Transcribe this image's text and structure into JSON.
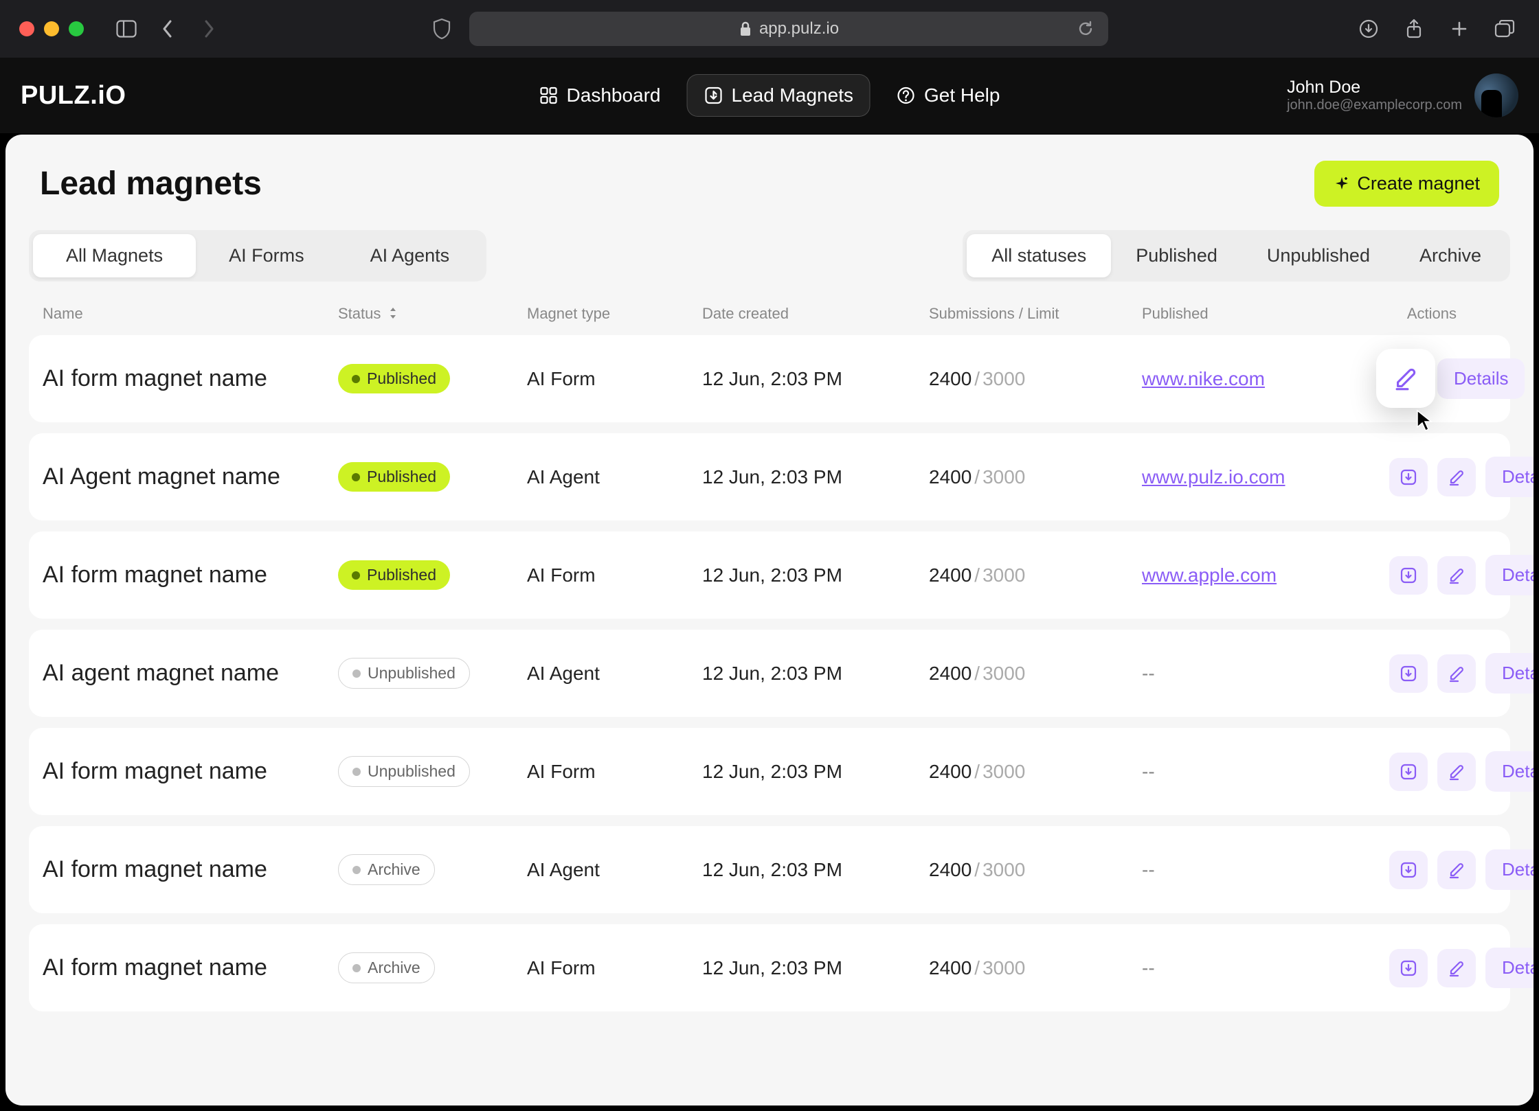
{
  "browser": {
    "url": "app.pulz.io"
  },
  "brand": {
    "logo_text": "PULZ.iO"
  },
  "nav": {
    "items": [
      {
        "label": "Dashboard",
        "active": false
      },
      {
        "label": "Lead Magnets",
        "active": true
      },
      {
        "label": "Get Help",
        "active": false
      }
    ]
  },
  "user": {
    "name": "John Doe",
    "email": "john.doe@examplecorp.com"
  },
  "page": {
    "title": "Lead magnets",
    "create_label": "Create magnet"
  },
  "type_filter": {
    "options": [
      "All Magnets",
      "AI Forms",
      "AI Agents"
    ],
    "active": "All Magnets"
  },
  "status_filter": {
    "options": [
      "All statuses",
      "Published",
      "Unpublished",
      "Archive"
    ],
    "active": "All statuses"
  },
  "table": {
    "columns": {
      "name": "Name",
      "status": "Status",
      "type": "Magnet type",
      "date": "Date created",
      "subs": "Submissions / Limit",
      "published": "Published",
      "actions": "Actions"
    },
    "details_label": "Details",
    "rows": [
      {
        "name": "AI form magnet name",
        "status": "Published",
        "type": "AI Form",
        "date": "12 Jun, 2:03 PM",
        "used": "2400",
        "limit": "3000",
        "published": "www.nike.com",
        "edit_hover": true
      },
      {
        "name": "AI Agent magnet name",
        "status": "Published",
        "type": "AI Agent",
        "date": "12 Jun, 2:03 PM",
        "used": "2400",
        "limit": "3000",
        "published": "www.pulz.io.com"
      },
      {
        "name": "AI form magnet name",
        "status": "Published",
        "type": "AI Form",
        "date": "12 Jun, 2:03 PM",
        "used": "2400",
        "limit": "3000",
        "published": "www.apple.com"
      },
      {
        "name": "AI agent magnet name",
        "status": "Unpublished",
        "type": "AI Agent",
        "date": "12 Jun, 2:03 PM",
        "used": "2400",
        "limit": "3000",
        "published": "--"
      },
      {
        "name": "AI form magnet name",
        "status": "Unpublished",
        "type": "AI Form",
        "date": "12 Jun, 2:03 PM",
        "used": "2400",
        "limit": "3000",
        "published": "--"
      },
      {
        "name": "AI form magnet name",
        "status": "Archive",
        "type": "AI Agent",
        "date": "12 Jun, 2:03 PM",
        "used": "2400",
        "limit": "3000",
        "published": "--"
      },
      {
        "name": "AI form magnet name",
        "status": "Archive",
        "type": "AI Form",
        "date": "12 Jun, 2:03 PM",
        "used": "2400",
        "limit": "3000",
        "published": "--"
      }
    ]
  }
}
